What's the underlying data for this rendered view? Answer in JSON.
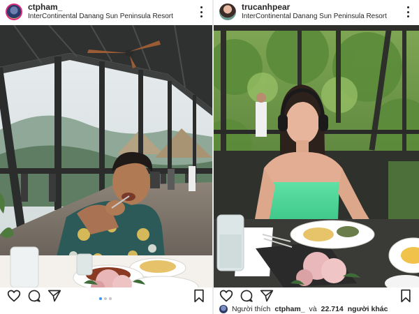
{
  "left_post": {
    "username": "ctpham_",
    "location": "InterContinental Danang Sun Peninsula Resort",
    "avatar_icon": "avatar-icon",
    "more_icon": "more-options-icon",
    "image": "man-eating-at-restaurant-photo",
    "carousel": {
      "count": 3,
      "active": 0
    },
    "actions": [
      "heart-icon",
      "comment-icon",
      "share-icon",
      "bookmark-icon"
    ]
  },
  "right_post": {
    "username": "trucanhpear",
    "location": "InterContinental Danang Sun Peninsula Resort",
    "avatar_icon": "avatar-icon",
    "more_icon": "more-options-icon",
    "image": "woman-with-headphones-at-table-photo",
    "actions": [
      "heart-icon",
      "comment-icon",
      "share-icon",
      "bookmark-icon"
    ],
    "likes": {
      "prefix": "Người thích",
      "user": "ctpham_",
      "conj": "và",
      "count": "22.714",
      "suffix": "người khác"
    }
  },
  "colors": {
    "active_dot": "#3897f0",
    "inactive_dot": "#c7c7c7",
    "text": "#262626",
    "ring": "#dd2a7b"
  }
}
